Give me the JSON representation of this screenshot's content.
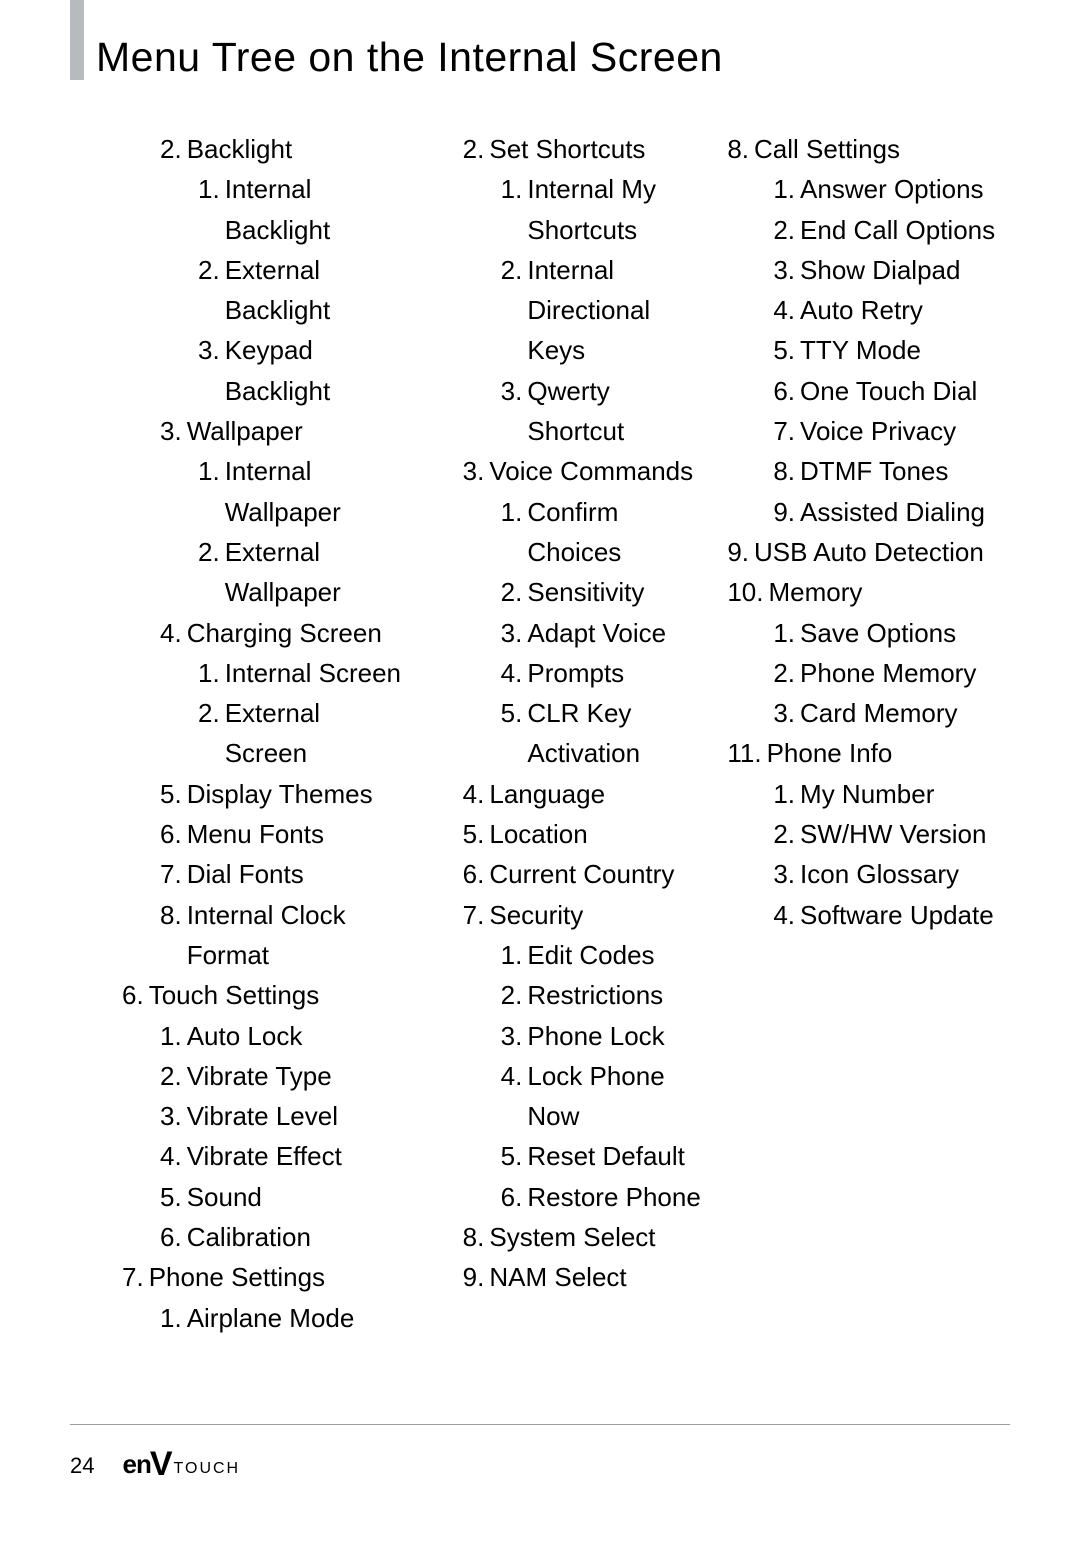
{
  "title": "Menu Tree on the Internal Screen",
  "page_number": "24",
  "brand": {
    "en": "en",
    "v": "V",
    "touch": "TOUCH"
  },
  "columns": [
    [
      {
        "n": "2.",
        "label": "Backlight",
        "lvl": 1
      },
      {
        "n": "1.",
        "label": "Internal Backlight",
        "lvl": 2
      },
      {
        "n": "2.",
        "label": "External Backlight",
        "lvl": 2
      },
      {
        "n": "3.",
        "label": "Keypad Backlight",
        "lvl": 2
      },
      {
        "n": "3.",
        "label": "Wallpaper",
        "lvl": 1
      },
      {
        "n": "1.",
        "label": "Internal Wallpaper",
        "lvl": 2
      },
      {
        "n": "2.",
        "label": "External Wallpaper",
        "lvl": 2
      },
      {
        "n": "4.",
        "label": "Charging Screen",
        "lvl": 1
      },
      {
        "n": "1.",
        "label": "Internal Screen",
        "lvl": 2
      },
      {
        "n": "2.",
        "label": "External Screen",
        "lvl": 2
      },
      {
        "n": "5.",
        "label": "Display Themes",
        "lvl": 1
      },
      {
        "n": "6.",
        "label": "Menu Fonts",
        "lvl": 1
      },
      {
        "n": "7.",
        "label": "Dial Fonts",
        "lvl": 1
      },
      {
        "n": "8.",
        "label": "Internal Clock Format",
        "lvl": 1
      },
      {
        "n": "6.",
        "label": "Touch Settings",
        "lvl": 0
      },
      {
        "n": "1.",
        "label": "Auto Lock",
        "lvl": 1
      },
      {
        "n": "2.",
        "label": "Vibrate Type",
        "lvl": 1
      },
      {
        "n": "3.",
        "label": "Vibrate Level",
        "lvl": 1
      },
      {
        "n": "4.",
        "label": "Vibrate Effect",
        "lvl": 1
      },
      {
        "n": "5.",
        "label": "Sound",
        "lvl": 1
      },
      {
        "n": "6.",
        "label": "Calibration",
        "lvl": 1
      },
      {
        "n": "7.",
        "label": "Phone Settings",
        "lvl": 0
      },
      {
        "n": "1.",
        "label": "Airplane Mode",
        "lvl": 1
      }
    ],
    [
      {
        "n": "2.",
        "label": "Set Shortcuts",
        "lvl": 1
      },
      {
        "n": "1.",
        "label": "Internal My Shortcuts",
        "lvl": 2
      },
      {
        "n": "2.",
        "label": "Internal Directional Keys",
        "lvl": 2
      },
      {
        "n": "3.",
        "label": "Qwerty Shortcut",
        "lvl": 2
      },
      {
        "n": "3.",
        "label": "Voice Commands",
        "lvl": 1
      },
      {
        "n": "1.",
        "label": "Confirm Choices",
        "lvl": 2
      },
      {
        "n": "2.",
        "label": "Sensitivity",
        "lvl": 2
      },
      {
        "n": "3.",
        "label": "Adapt Voice",
        "lvl": 2
      },
      {
        "n": "4.",
        "label": "Prompts",
        "lvl": 2
      },
      {
        "n": "5.",
        "label": "CLR Key Activation",
        "lvl": 2
      },
      {
        "n": "4.",
        "label": "Language",
        "lvl": 1
      },
      {
        "n": "5.",
        "label": "Location",
        "lvl": 1
      },
      {
        "n": "6.",
        "label": "Current Country",
        "lvl": 1
      },
      {
        "n": "7.",
        "label": "Security",
        "lvl": 1
      },
      {
        "n": "1.",
        "label": "Edit Codes",
        "lvl": 2
      },
      {
        "n": "2.",
        "label": "Restrictions",
        "lvl": 2
      },
      {
        "n": "3.",
        "label": "Phone Lock",
        "lvl": 2
      },
      {
        "n": "4.",
        "label": "Lock Phone Now",
        "lvl": 2
      },
      {
        "n": "5.",
        "label": "Reset Default",
        "lvl": 2
      },
      {
        "n": "6.",
        "label": "Restore Phone",
        "lvl": 2
      },
      {
        "n": "8.",
        "label": "System Select",
        "lvl": 1
      },
      {
        "n": "9.",
        "label": "NAM Select",
        "lvl": 1
      }
    ],
    [
      {
        "n": "8.",
        "label": "Call Settings",
        "lvl": 0
      },
      {
        "n": "1.",
        "label": "Answer Options",
        "lvl": 1
      },
      {
        "n": "2.",
        "label": "End Call Options",
        "lvl": 1
      },
      {
        "n": "3.",
        "label": "Show Dialpad",
        "lvl": 1
      },
      {
        "n": "4.",
        "label": "Auto Retry",
        "lvl": 1
      },
      {
        "n": "5.",
        "label": "TTY Mode",
        "lvl": 1
      },
      {
        "n": "6.",
        "label": "One Touch Dial",
        "lvl": 1
      },
      {
        "n": "7.",
        "label": "Voice Privacy",
        "lvl": 1
      },
      {
        "n": "8.",
        "label": "DTMF Tones",
        "lvl": 1
      },
      {
        "n": "9.",
        "label": "Assisted Dialing",
        "lvl": 1
      },
      {
        "n": "9.",
        "label": "USB Auto Detection",
        "lvl": 0
      },
      {
        "n": "10.",
        "label": "Memory",
        "lvl": 0
      },
      {
        "n": "1.",
        "label": "Save Options",
        "lvl": 1
      },
      {
        "n": "2.",
        "label": "Phone Memory",
        "lvl": 1
      },
      {
        "n": "3.",
        "label": "Card Memory",
        "lvl": 1
      },
      {
        "n": "11.",
        "label": "Phone Info",
        "lvl": 0
      },
      {
        "n": "1.",
        "label": "My Number",
        "lvl": 1
      },
      {
        "n": "2.",
        "label": "SW/HW Version",
        "lvl": 1
      },
      {
        "n": "3.",
        "label": "Icon Glossary",
        "lvl": 1
      },
      {
        "n": "4.",
        "label": "Software Update",
        "lvl": 1
      }
    ]
  ],
  "indents": {
    "col1": {
      "0": 0,
      "1": 38,
      "2": 76
    },
    "col2": {
      "0": 0,
      "1": 38,
      "2": 76
    },
    "col3_level0_wide": -18
  }
}
